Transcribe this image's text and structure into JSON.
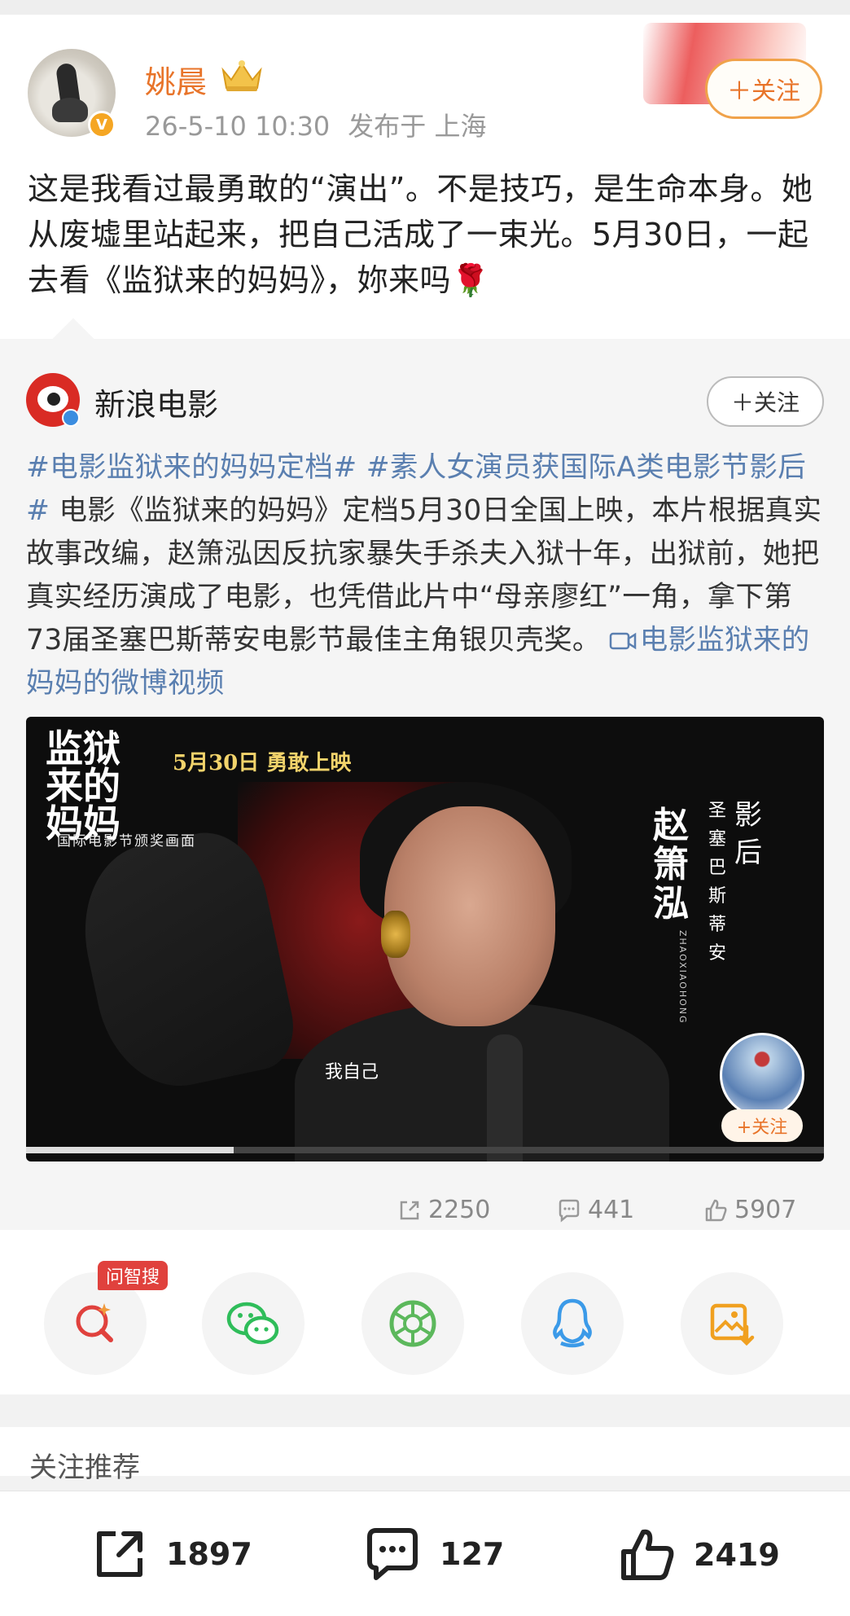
{
  "post": {
    "username": "姚晨",
    "time": "26-5-10 10:30",
    "location": "发布于 上海",
    "follow_label": "＋关注",
    "text": "这是我看过最勇敢的“演出”。不是技巧，是生命本身。她从废墟里站起来，把自己活成了一束光。5月30日，一起去看《监狱来的妈妈》，妳来吗🌹"
  },
  "repost": {
    "author": "新浪电影",
    "follow_label": "＋关注",
    "hashtag1": "#电影监狱来的妈妈定档#",
    "hashtag2": "#素人女演员获国际A类电影节影后#",
    "body": " 电影《监狱来的妈妈》定档5月30日全国上映，本片根据真实故事改编，赵箫泓因反抗家暴失手杀夫入狱十年，出狱前，她把真实经历演成了电影，也凭借此片中“母亲廖红”一角，拿下第73届圣塞巴斯蒂安电影节最佳主角银贝壳奖。",
    "video_link": "电影监狱来的妈妈的微博视频",
    "video": {
      "logo_text": "监狱来的妈妈",
      "date_text": "5月30日  勇敢上映",
      "sub_text": "国际电影节颁奖画面",
      "actress_name": "赵箫泓",
      "pinyin": "ZHAOXIAOHONG",
      "festival": "圣塞巴斯蒂安",
      "award": "影后",
      "caption": "我自己",
      "follow_label": "+关注",
      "progress": 0.26
    },
    "stats": {
      "shares": "2250",
      "comments": "441",
      "likes": "5907"
    }
  },
  "share": {
    "ai_badge": "问智搜",
    "icons": [
      "ai-search-icon",
      "wechat-icon",
      "moments-icon",
      "qq-icon",
      "save-image-icon"
    ],
    "colors": {
      "ai": "#e0413d",
      "wechat": "#2fbd5a",
      "moments": "#5cb85c",
      "qq": "#3b9ae8",
      "save": "#f0a020"
    }
  },
  "recommend": {
    "title": "关注推荐"
  },
  "bottom": {
    "shares": "1897",
    "comments": "127",
    "likes": "2419"
  },
  "colors": {
    "accent": "#e8742a",
    "link": "#5a7fb0"
  }
}
